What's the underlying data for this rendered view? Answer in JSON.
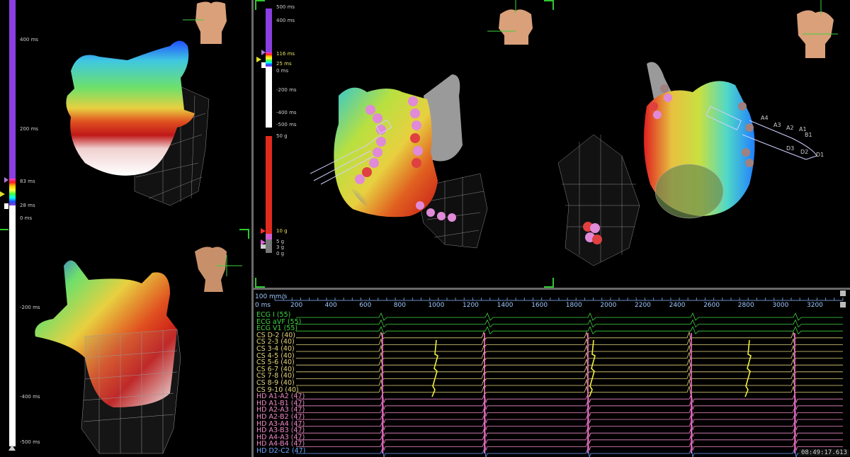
{
  "scale_left": {
    "ticks": [
      "400 ms",
      "200 ms",
      "83 ms",
      "28 ms",
      "0 ms",
      "-200 ms",
      "-400 ms",
      "-500 ms"
    ],
    "colors": {
      "purple": "#8a3fe0",
      "white": "#ffffff"
    }
  },
  "scale_mid": {
    "ticks": [
      "500 ms",
      "400 ms",
      "116 ms",
      "25 ms",
      "0 ms",
      "-200 ms",
      "-400 ms",
      "-500 ms"
    ],
    "force_ticks": [
      "50 g",
      "10 g",
      "5 g",
      "3 g",
      "0 g"
    ],
    "colors": {
      "purple": "#8a3fe0",
      "red": "#e12a1e",
      "white": "#ffffff"
    }
  },
  "timeline": {
    "speed": "100 mm/s",
    "start": "0 ms",
    "ticks": [
      "200",
      "400",
      "600",
      "800",
      "1000",
      "1200",
      "1400",
      "1600",
      "1800",
      "2000",
      "2200",
      "2400",
      "2600",
      "2800",
      "3000",
      "3200",
      "3"
    ],
    "clock": "08:49:17.613"
  },
  "channels": [
    {
      "label": "ECG I (55)",
      "group": "ecg"
    },
    {
      "label": "ECG aVF (55)",
      "group": "ecg"
    },
    {
      "label": "ECG V1 (55)",
      "group": "ecg"
    },
    {
      "label": "CS  D-2 (40)",
      "group": "cs"
    },
    {
      "label": "CS  2-3 (40)",
      "group": "cs"
    },
    {
      "label": "CS  3-4 (40)",
      "group": "cs"
    },
    {
      "label": "CS  4-5 (40)",
      "group": "cs"
    },
    {
      "label": "CS  5-6 (40)",
      "group": "cs"
    },
    {
      "label": "CS  6-7 (40)",
      "group": "cs"
    },
    {
      "label": "CS  7-8 (40)",
      "group": "cs"
    },
    {
      "label": "CS  8-9 (40)",
      "group": "cs"
    },
    {
      "label": "CS  9-10 (40)",
      "group": "cs"
    },
    {
      "label": "HD  A1-A2 (47)",
      "group": "hd"
    },
    {
      "label": "HD  A1-B1 (47)",
      "group": "hd"
    },
    {
      "label": "HD  A2-A3 (47)",
      "group": "hd"
    },
    {
      "label": "HD  A2-B2 (47)",
      "group": "hd"
    },
    {
      "label": "HD  A3-A4 (47)",
      "group": "hd"
    },
    {
      "label": "HD  A3-B3 (47)",
      "group": "hd"
    },
    {
      "label": "HD  A4-A3 (47)",
      "group": "hd"
    },
    {
      "label": "HD  A4-B4 (47)",
      "group": "hd"
    },
    {
      "label": "HD  D2-C2 (47)",
      "group": "hd2"
    }
  ],
  "catheter_labels": [
    "A4",
    "A3",
    "A2",
    "A1",
    "B1",
    "D3",
    "D2",
    "D1"
  ],
  "colors": {
    "ecg": "#3fd23f",
    "cs": "#e3d37a",
    "hd": "#f08ac8",
    "hd2": "#6aa6ff",
    "frame": "#2ec82e"
  }
}
